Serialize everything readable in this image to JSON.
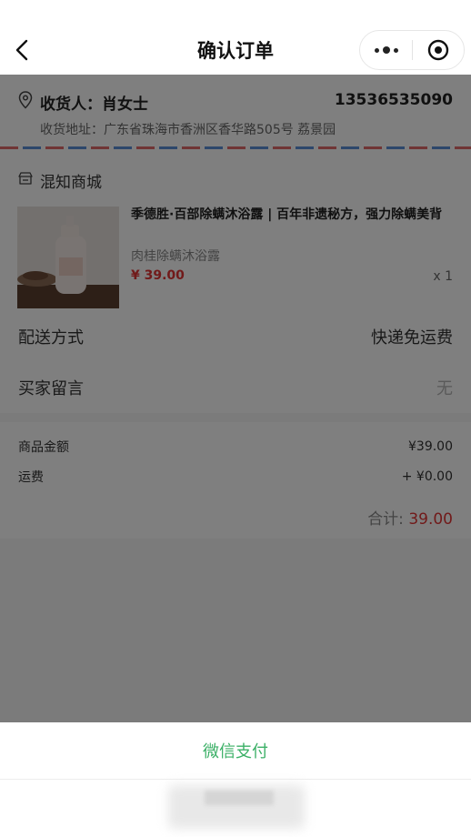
{
  "nav": {
    "title": "确认订单"
  },
  "address": {
    "name": "收货人：肖女士",
    "phone": "13536535090",
    "detail": "收货地址：广东省珠海市香洲区香华路505号 荔景园"
  },
  "store": {
    "name": "混知商城"
  },
  "product": {
    "title": "季德胜·百部除螨沐浴露 | 百年非遗秘方，强力除螨美背",
    "spec": "肉桂除螨沐浴露",
    "price": "¥ 39.00",
    "qty": "x 1"
  },
  "delivery": {
    "label": "配送方式",
    "value": "快递免运费"
  },
  "message": {
    "label": "买家留言",
    "value": "无"
  },
  "amounts": {
    "goods_label": "商品金额",
    "goods_value": "¥39.00",
    "freight_label": "运费",
    "freight_value": "+ ¥0.00",
    "total_label": "合计:",
    "total_value": "39.00"
  },
  "sheet": {
    "pay_label": "微信支付"
  },
  "colors": {
    "accent_green": "#3cb067",
    "price_red": "#e23434"
  },
  "icons": [
    "back-arrow-icon",
    "more-dots-icon",
    "target-icon",
    "location-pin-icon",
    "store-icon"
  ]
}
